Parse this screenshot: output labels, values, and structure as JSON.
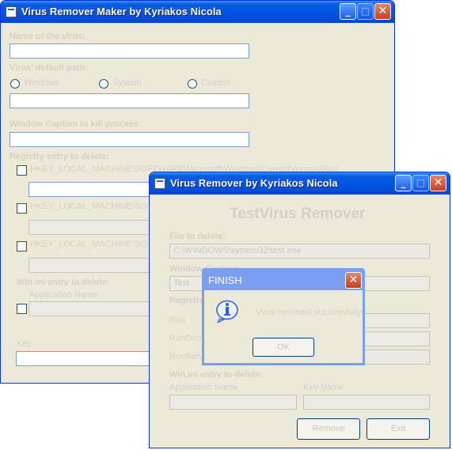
{
  "maker_window": {
    "title": "Virus Remover Maker by Kyriakos Nicola",
    "name_label": "Name of the virus:",
    "default_path_label": "Virus' default path:",
    "path_options": [
      "Windows",
      "System",
      "Custom"
    ],
    "window_caption_label": "Window Caption to kill process:",
    "registry_label": "Registry entry to delete:",
    "registry_items": [
      "HKEY_LOCAL_MACHINE\\SOFTWARE\\Microsoft\\Windows\\CurrentVersion\\Run",
      "HKEY_LOCAL_MACHINE\\SO",
      "HKEY_LOCAL_MACHINE\\SO"
    ],
    "winini_label": "Win.ini entry to delete:",
    "application_name_label": "Application Name",
    "key_label": "Key"
  },
  "remover_window": {
    "title": "Virus Remover by Kyriakos Nicola",
    "heading": "TestVirus Remover",
    "file_label": "File to delete:",
    "file_value": "C:\\WINDOWS\\system32\\test.exe",
    "window_caption_label": "Window Caption:",
    "window_caption_value": "Test",
    "registry_label": "Registry entry",
    "registry_rows": [
      "Run",
      "RunOnce",
      "RunServices"
    ],
    "winini_label": "Win.ini entry to delete:",
    "application_name_label": "Application Name",
    "key_name_label": "Key Name",
    "remove_button": "Remove",
    "exit_button": "Exit"
  },
  "dialog": {
    "title": "FINISH",
    "message": "Virus removed successfully!",
    "ok_button": "OK"
  },
  "caption_buttons": {
    "minimize": "_",
    "maximize": "□",
    "close": "✕"
  },
  "icons": {
    "window": "app-window-icon",
    "info": "info-icon"
  },
  "colors": {
    "titlebar": "#0054e3",
    "dialog_titlebar": "#7b9ef2",
    "window_bg": "#ece9d8",
    "close": "#d35b3a"
  }
}
